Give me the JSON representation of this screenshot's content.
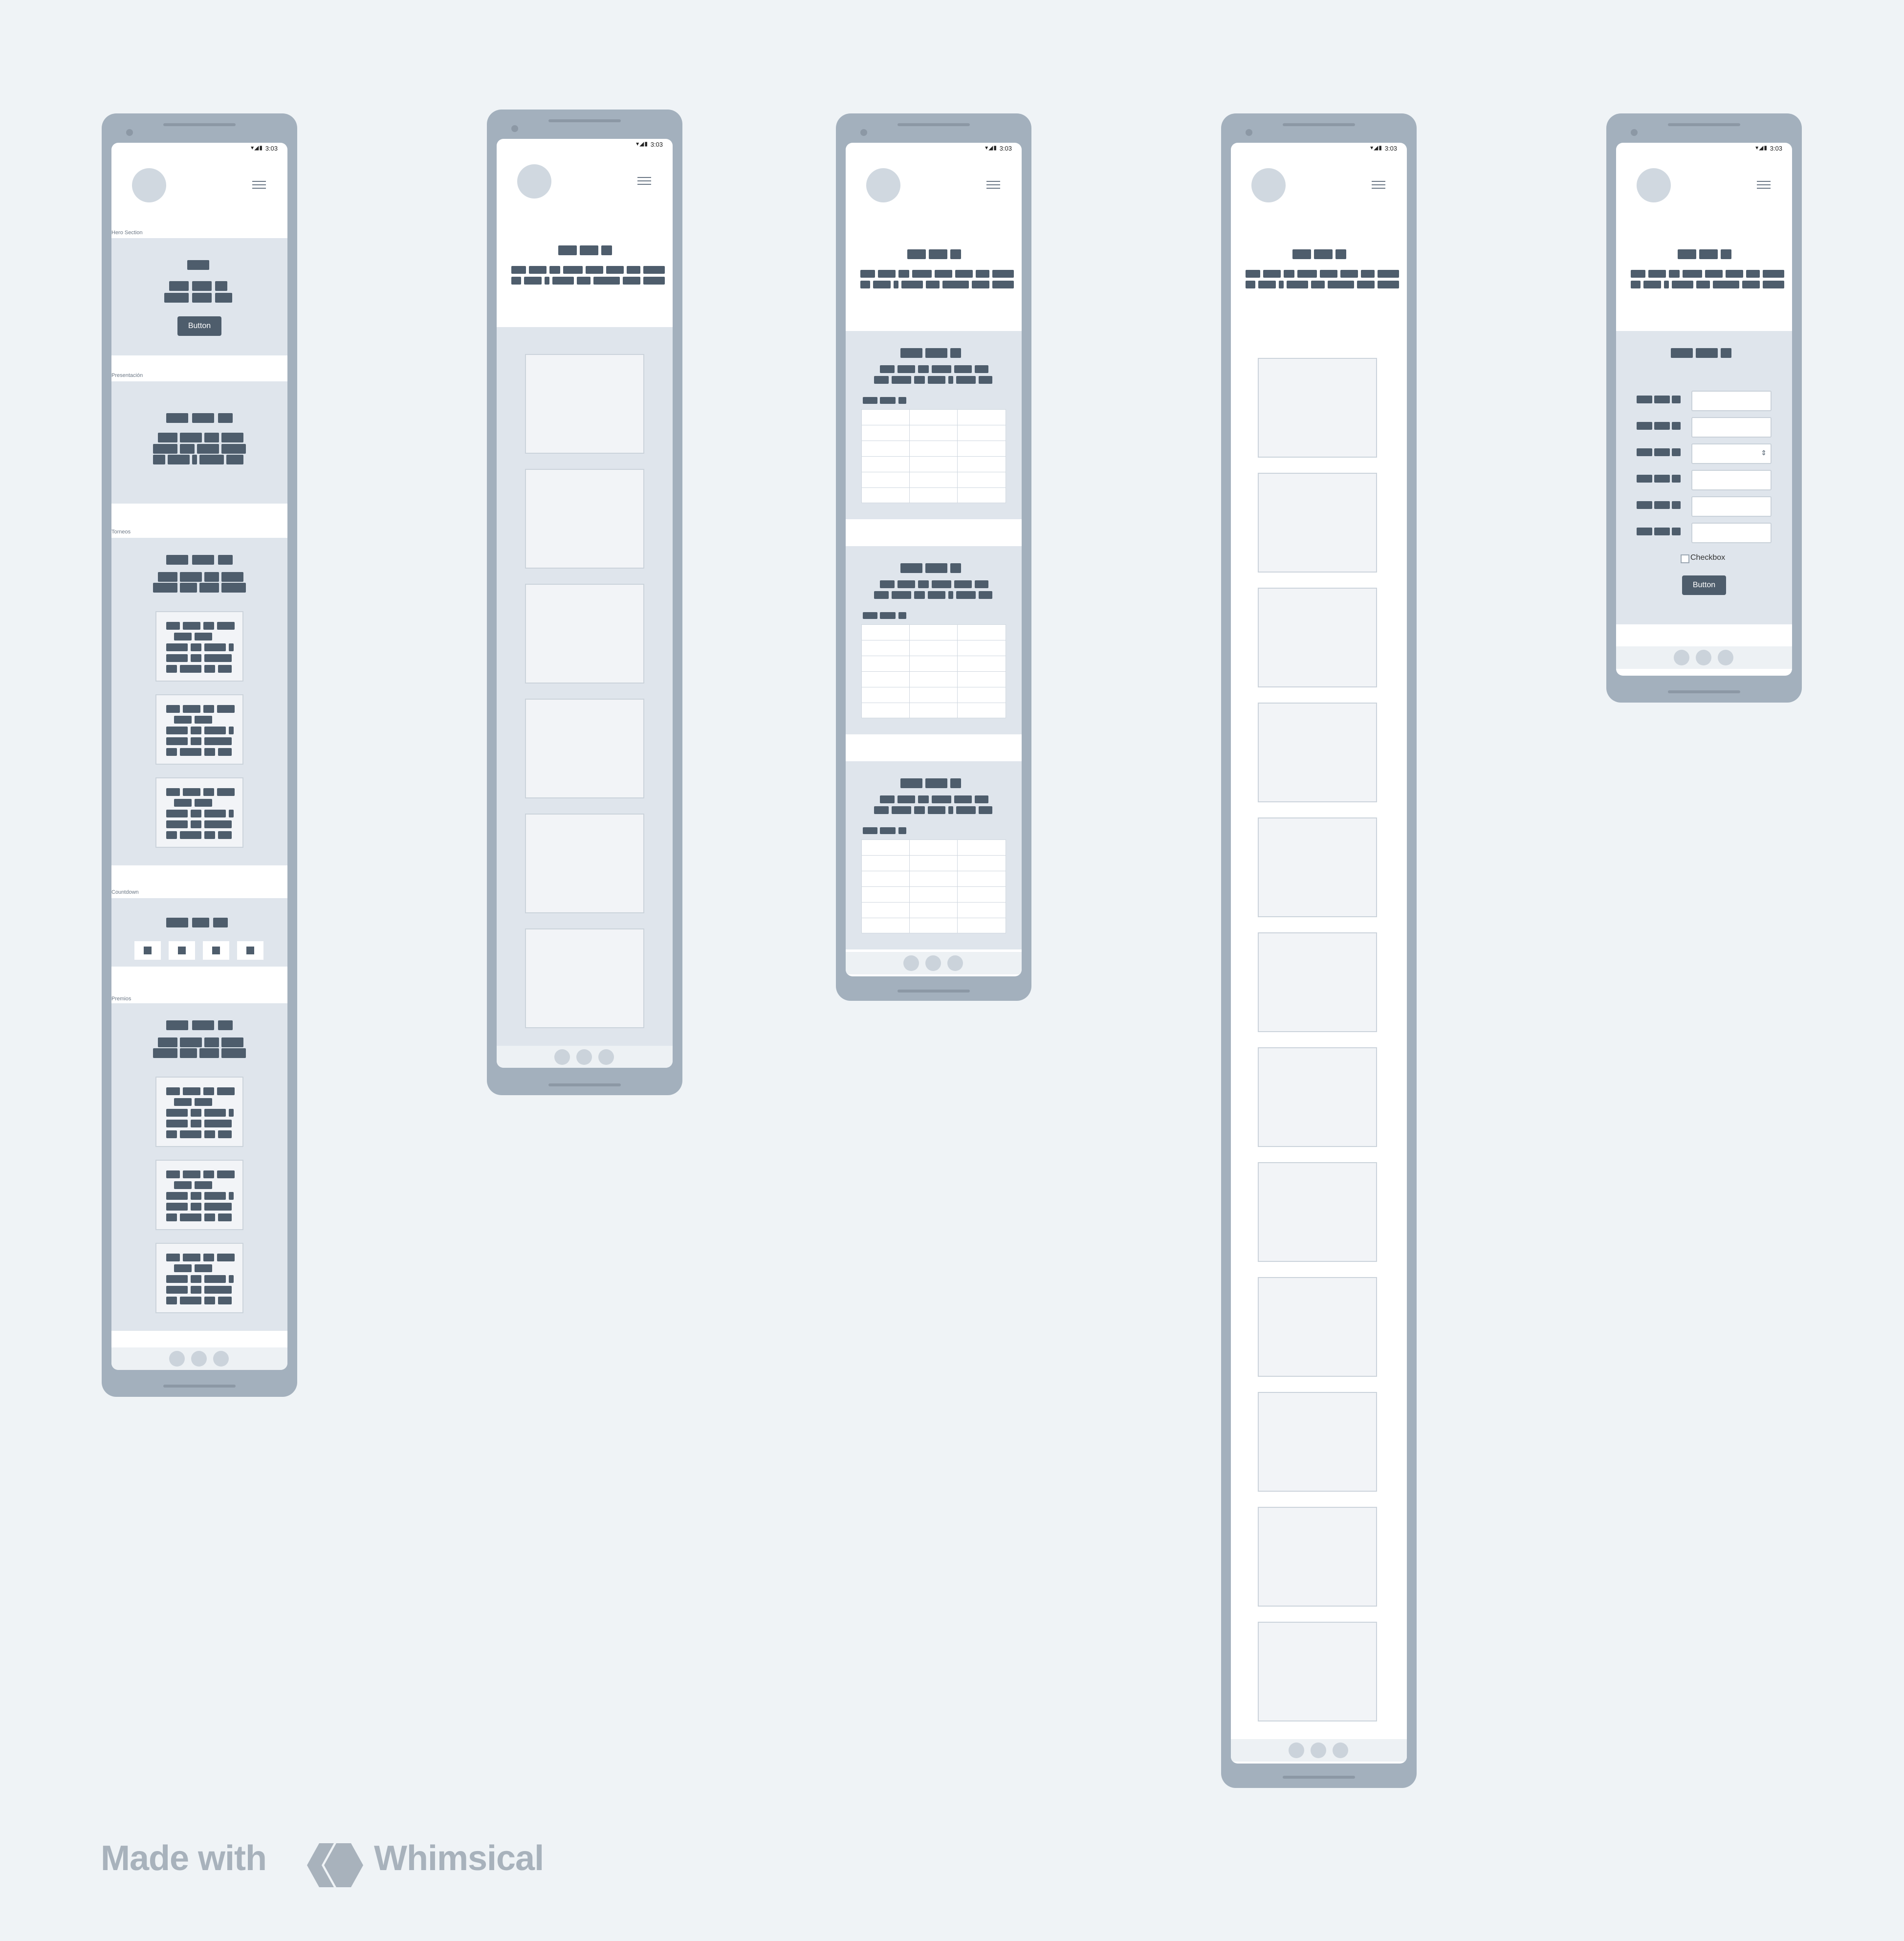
{
  "status_bar": {
    "time": "3:03",
    "icons": "▾◢▮"
  },
  "home": {
    "sections": {
      "hero": "Hero Section",
      "presentacion": "Presentación",
      "torneos": "Torneos",
      "countdown": "Countdown",
      "premios": "Premios"
    },
    "hero_button": "Button"
  },
  "form": {
    "checkbox_label": "Checkbox",
    "submit_button": "Button",
    "select_arrow": "⇕"
  },
  "branding": {
    "made_with": "Made with",
    "brand": "Whimsical"
  },
  "colors": {
    "device_frame": "#a3b0bd",
    "section_bg": "#dfe5ec",
    "placeholder_text_block": "#4e5d6c",
    "canvas_bg": "#eff3f6"
  }
}
